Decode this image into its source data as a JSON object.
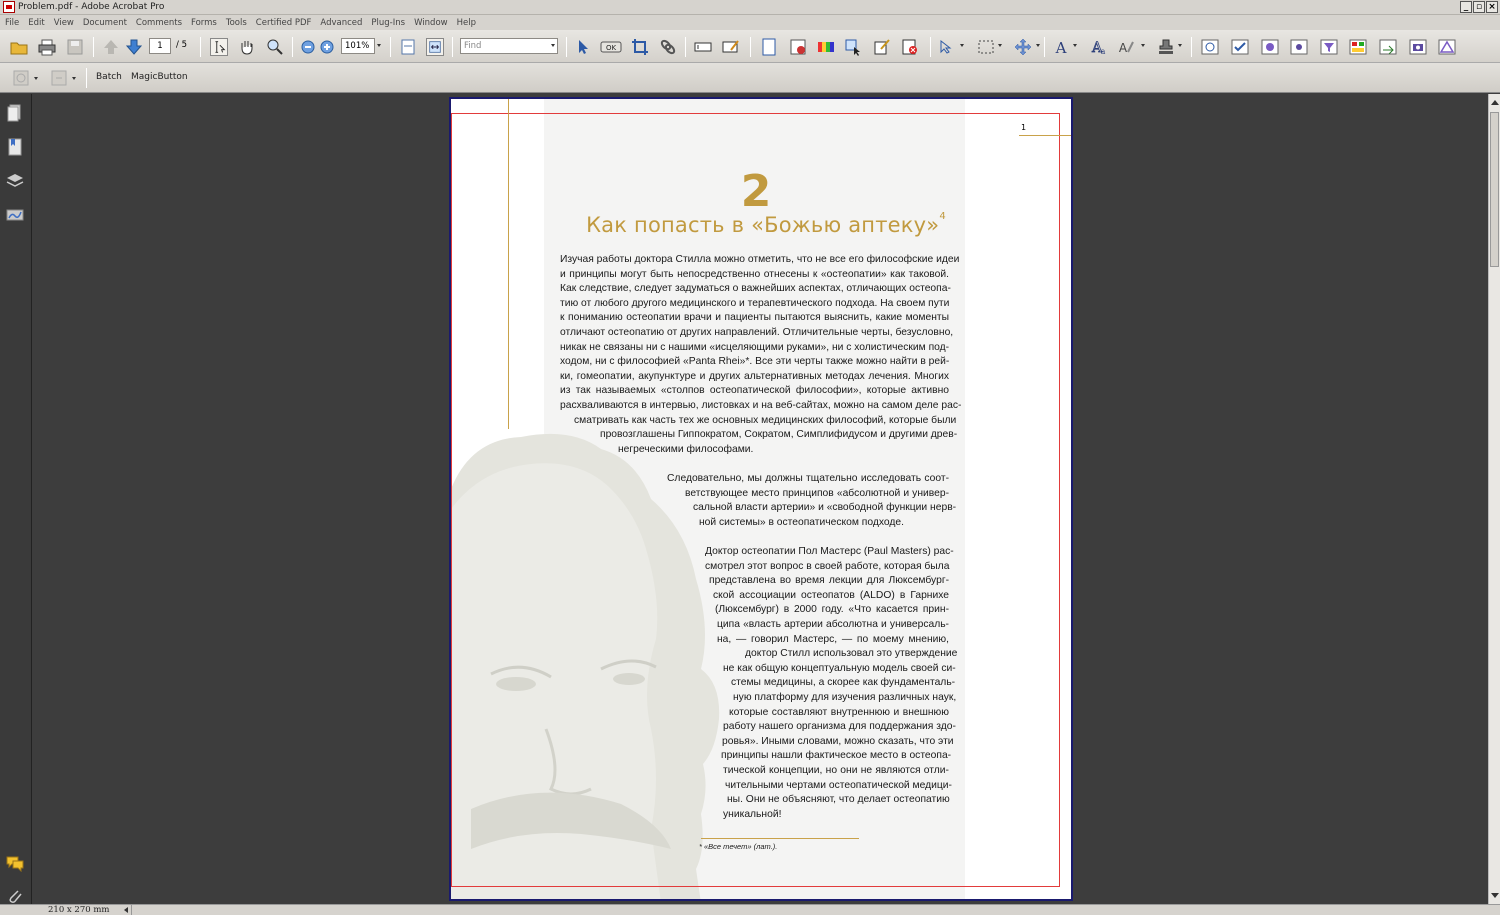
{
  "window": {
    "title": "Problem.pdf - Adobe Acrobat Pro"
  },
  "menu": [
    "File",
    "Edit",
    "View",
    "Document",
    "Comments",
    "Forms",
    "Tools",
    "Certified PDF",
    "Advanced",
    "Plug-Ins",
    "Window",
    "Help"
  ],
  "toolbar": {
    "page_current": "1",
    "page_total": "/ 5",
    "zoom": "101%",
    "find_placeholder": "Find"
  },
  "toolbar2": {
    "batch_label": "Batch",
    "magic_label": "MagicButton"
  },
  "page": {
    "page_number": "1",
    "chapter_number": "2",
    "chapter_title": "Как попасть в «Божью аптеку»",
    "chapter_title_sup": "4",
    "para1": [
      "Изучая работы доктора Стилла можно отметить, что не все его философские идеи",
      "и принципы могут быть непосредственно отнесены к «остеопатии» как таковой.",
      "Как следствие, следует задуматься о важнейших аспектах, отличающих остеопа-",
      "тию от любого другого медицинского и терапевтического подхода. На своем пути",
      "к пониманию остеопатии врачи и пациенты пытаются выяснить, какие моменты",
      "отличают остеопатию от других направлений. Отличительные черты, безусловно,",
      "никак не связаны ни с нашими «исцеляющими руками», ни с холистическим под-",
      "ходом, ни с философией «Panta Rhei»*. Все эти черты также можно найти в рей-",
      "ки, гомеопатии, акупунктуре и других альтернативных методах лечения. Многих",
      "из так называемых «столпов остеопатической философии», которые активно",
      "расхваливаются в интервью, листовках и на веб-сайтах, можно на самом деле рас-",
      "сматривать как часть тех же основных медицинских философий, которые были",
      "провозглашены Гиппократом, Сократом, Симплифидусом и другими древ-",
      "негреческими философами."
    ],
    "para2": [
      "Следовательно, мы должны тщательно исследовать соот-",
      "ветствующее место принципов «абсолютной и универ-",
      "сальной власти артерии» и «свободной функции нерв-",
      "ной системы» в остеопатическом подходе."
    ],
    "para3": [
      "Доктор остеопатии Пол Мастерс (Paul Masters) рас-",
      "смотрел этот вопрос в своей работе, которая была",
      "представлена во время лекции для Люксембург-",
      "ской ассоциации остеопатов (ALDO) в Гарнихе",
      "(Люксембург) в 2000 году. «Что касается прин-",
      "ципа «власть артерии абсолютна и универсаль-",
      "на, — говорил Мастерс, — по моему мнению,",
      "доктор Стилл использовал это утверждение",
      "не как общую концептуальную модель своей си-",
      "стемы медицины, а скорее как фундаменталь-",
      "ную платформу для изучения различных наук,",
      "которые составляют внутреннюю и внешнюю",
      "работу нашего организма для поддержания здо-",
      "ровья». Иными словами, можно сказать, что эти",
      "принципы нашли фактическое место в остеопа-",
      "тической концепции, но они не являются отли-",
      "чительными чертами остеопатической медици-",
      "ны. Они не объясняют, что делает остеопатию",
      "уникальной!"
    ],
    "footnote": "*  «Все течет» (лат.)."
  },
  "status": {
    "page_size": "210 x 270 mm"
  },
  "colors": {
    "accent_gold": "#c19a3f",
    "trim_red": "#e23b3b",
    "viewer_bg": "#3d3d3d"
  }
}
